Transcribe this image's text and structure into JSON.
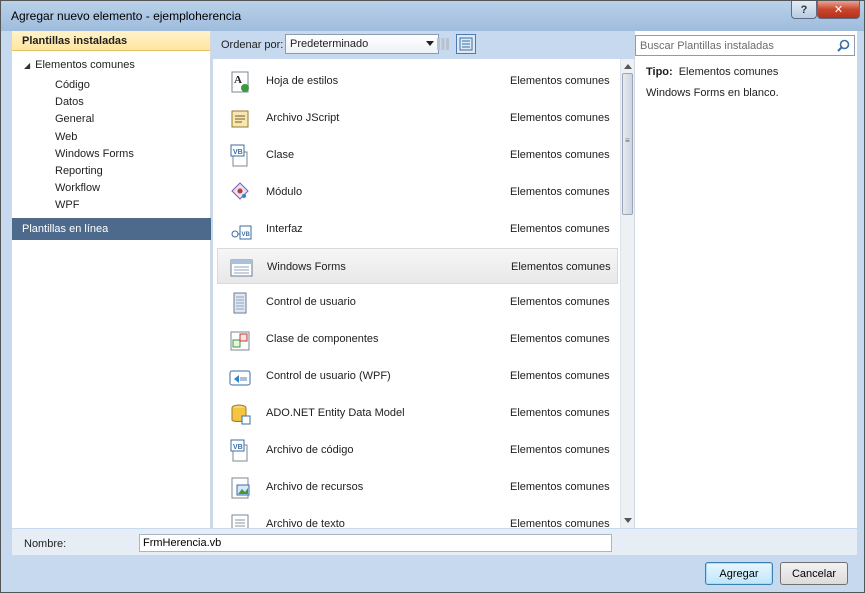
{
  "window": {
    "title": "Agregar nuevo elemento - ejemploherencia",
    "help_label": "?",
    "close_label": "✕"
  },
  "left": {
    "header": "Plantillas instaladas",
    "tree_root": "Elementos comunes",
    "children": [
      "Código",
      "Datos",
      "General",
      "Web",
      "Windows Forms",
      "Reporting",
      "Workflow",
      "WPF"
    ],
    "online": "Plantillas en línea"
  },
  "toolbar": {
    "order_label": "Ordenar por:",
    "order_value": "Predeterminado"
  },
  "items": [
    {
      "name": "Hoja de estilos",
      "category": "Elementos comunes",
      "icon": "stylesheet-icon"
    },
    {
      "name": "Archivo JScript",
      "category": "Elementos comunes",
      "icon": "jscript-icon"
    },
    {
      "name": "Clase",
      "category": "Elementos comunes",
      "icon": "vb-class-icon"
    },
    {
      "name": "Módulo",
      "category": "Elementos comunes",
      "icon": "module-icon"
    },
    {
      "name": "Interfaz",
      "category": "Elementos comunes",
      "icon": "interface-icon"
    },
    {
      "name": "Windows Forms",
      "category": "Elementos comunes",
      "icon": "windows-form-icon"
    },
    {
      "name": "Control de usuario",
      "category": "Elementos comunes",
      "icon": "user-control-icon"
    },
    {
      "name": "Clase de componentes",
      "category": "Elementos comunes",
      "icon": "component-class-icon"
    },
    {
      "name": "Control de usuario (WPF)",
      "category": "Elementos comunes",
      "icon": "wpf-user-control-icon"
    },
    {
      "name": "ADO.NET Entity Data Model",
      "category": "Elementos comunes",
      "icon": "entity-model-icon"
    },
    {
      "name": "Archivo de código",
      "category": "Elementos comunes",
      "icon": "code-file-icon"
    },
    {
      "name": "Archivo de recursos",
      "category": "Elementos comunes",
      "icon": "resource-file-icon"
    },
    {
      "name": "Archivo de texto",
      "category": "Elementos comunes",
      "icon": "text-file-icon"
    }
  ],
  "selected_item": "Windows Forms",
  "right": {
    "search_placeholder": "Buscar Plantillas instaladas",
    "type_label": "Tipo:",
    "type_value": "Elementos comunes",
    "description": "Windows Forms en blanco."
  },
  "bottom": {
    "name_label": "Nombre:",
    "name_value": "FrmHerencia.vb",
    "ok_label": "Agregar",
    "cancel_label": "Cancelar"
  }
}
